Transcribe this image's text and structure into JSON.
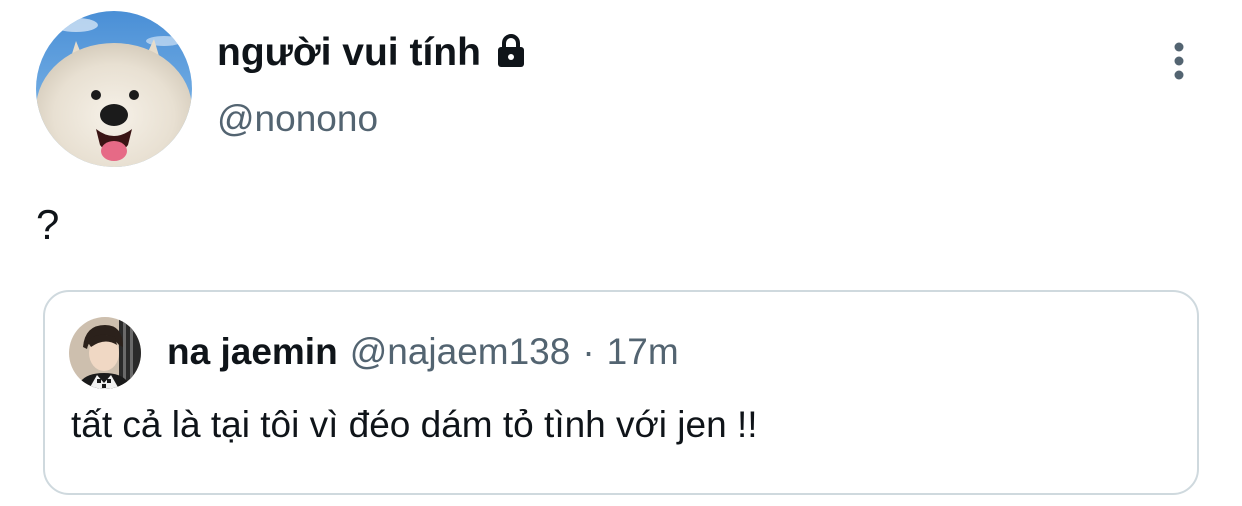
{
  "tweet": {
    "author": {
      "display_name": "người vui tính",
      "handle": "@nonono",
      "avatar_icon": "samoyed-dog-avatar",
      "protected_icon": "lock-icon"
    },
    "more_icon": "more-vertical-icon",
    "text": "?"
  },
  "quote": {
    "author": {
      "display_name": "na jaemin",
      "handle": "@najaem138",
      "separator": "·",
      "time": "17m",
      "avatar_icon": "person-avatar"
    },
    "text": "tất cả là tại tôi vì đéo dám tỏ tình với jen !!"
  },
  "colors": {
    "primary_text": "#0f1419",
    "secondary_text": "#536471",
    "border": "#cfd9de",
    "background": "#ffffff"
  }
}
